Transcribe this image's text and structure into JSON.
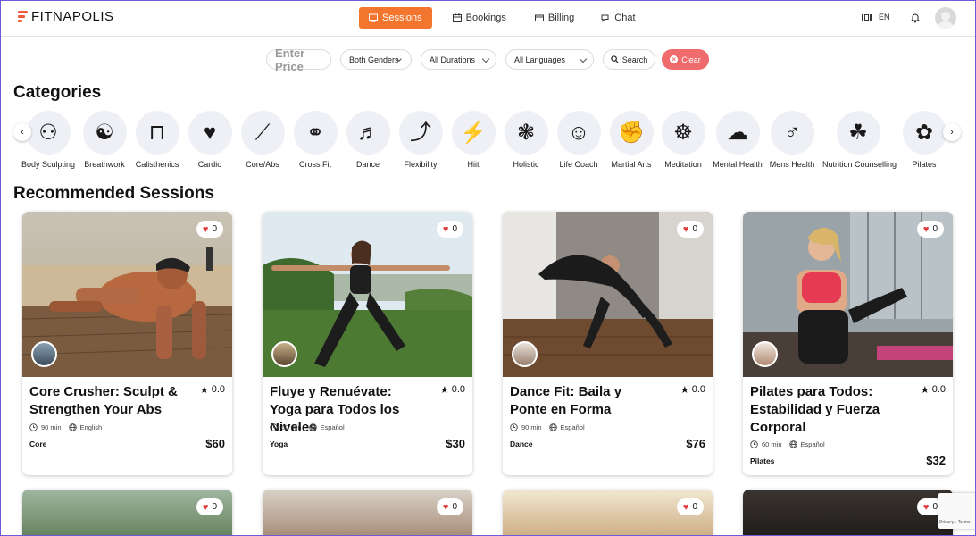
{
  "brand": {
    "name": "FITNAPOLIS",
    "accent": "#f4752e"
  },
  "nav": {
    "tabs": [
      {
        "label": "Sessions",
        "icon": "monitor-icon",
        "active": true
      },
      {
        "label": "Bookings",
        "icon": "calendar-icon"
      },
      {
        "label": "Billing",
        "icon": "card-icon"
      },
      {
        "label": "Chat",
        "icon": "chat-icon"
      }
    ],
    "language": "EN"
  },
  "filters": {
    "price_placeholder": "Enter Price",
    "gender": "Both Genders",
    "duration": "All Durations",
    "language": "All Languages",
    "search_label": "Search",
    "clear_label": "Clear"
  },
  "categories_heading": "Categories",
  "categories": [
    {
      "label": "Body Sculpting",
      "icon": "body-sculpting-icon"
    },
    {
      "label": "Breathwork",
      "icon": "breathwork-icon"
    },
    {
      "label": "Calisthenics",
      "icon": "calisthenics-icon"
    },
    {
      "label": "Cardio",
      "icon": "cardio-icon"
    },
    {
      "label": "Core/Abs",
      "icon": "core-abs-icon"
    },
    {
      "label": "Cross Fit",
      "icon": "cross-fit-icon"
    },
    {
      "label": "Dance",
      "icon": "dance-icon"
    },
    {
      "label": "Flexibility",
      "icon": "flexibility-icon"
    },
    {
      "label": "Hiit",
      "icon": "hiit-icon"
    },
    {
      "label": "Holistic",
      "icon": "holistic-icon"
    },
    {
      "label": "Life Coach",
      "icon": "life-coach-icon"
    },
    {
      "label": "Martial Arts",
      "icon": "martial-arts-icon"
    },
    {
      "label": "Meditation",
      "icon": "meditation-icon"
    },
    {
      "label": "Mental Health",
      "icon": "mental-health-icon"
    },
    {
      "label": "Mens Health",
      "icon": "mens-health-icon"
    },
    {
      "label": "Nutrition Counselling",
      "icon": "nutrition-icon"
    },
    {
      "label": "Pilates",
      "icon": "pilates-icon"
    }
  ],
  "recommended_heading": "Recommended Sessions",
  "sessions": [
    {
      "title": "Core Crusher: Sculpt & Strengthen Your Abs",
      "rating": "0.0",
      "likes": "0",
      "duration": "90 min",
      "language": "English",
      "category": "Core",
      "price": "$60"
    },
    {
      "title": "Fluye y Renuévate: Yoga para Todos los Niveles",
      "rating": "0.0",
      "likes": "0",
      "duration": "60 min",
      "language": "Español",
      "category": "Yoga",
      "price": "$30"
    },
    {
      "title": "Dance Fit: Baila y Ponte en Forma",
      "rating": "0.0",
      "likes": "0",
      "duration": "90 min",
      "language": "Español",
      "category": "Dance",
      "price": "$76"
    },
    {
      "title": "Pilates para Todos: Estabilidad y Fuerza Corporal",
      "rating": "0.0",
      "likes": "0",
      "duration": "60 min",
      "language": "Español",
      "category": "Pilates",
      "price": "$32"
    }
  ],
  "second_row_likes": [
    "0",
    "0",
    "0",
    "0"
  ],
  "recaptcha_text": "Privacy - Terms"
}
